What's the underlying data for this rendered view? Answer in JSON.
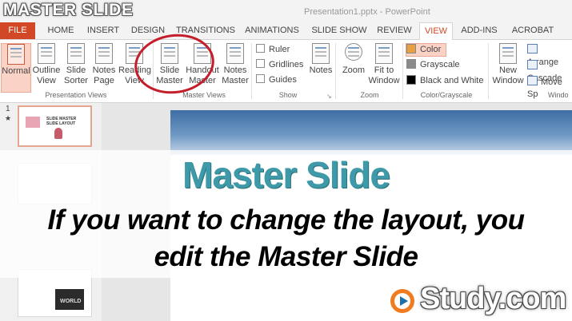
{
  "video_title": "MASTER SLIDE",
  "document_title": "Presentation1.pptx - PowerPoint",
  "tabs": [
    {
      "label": "FILE"
    },
    {
      "label": "HOME"
    },
    {
      "label": "INSERT"
    },
    {
      "label": "DESIGN"
    },
    {
      "label": "TRANSITIONS"
    },
    {
      "label": "ANIMATIONS"
    },
    {
      "label": "SLIDE SHOW"
    },
    {
      "label": "REVIEW"
    },
    {
      "label": "VIEW"
    },
    {
      "label": "ADD-INS"
    },
    {
      "label": "ACROBAT"
    }
  ],
  "active_tab": "VIEW",
  "ribbon": {
    "presentation_views": {
      "label": "Presentation Views",
      "normal": {
        "line1": "Normal",
        "line2": ""
      },
      "outline": {
        "line1": "Outline",
        "line2": "View"
      },
      "sorter": {
        "line1": "Slide",
        "line2": "Sorter"
      },
      "notes_page": {
        "line1": "Notes",
        "line2": "Page"
      },
      "reading": {
        "line1": "Reading",
        "line2": "View"
      }
    },
    "master_views": {
      "label": "Master Views",
      "slide_master": {
        "line1": "Slide",
        "line2": "Master"
      },
      "handout_master": {
        "line1": "Handout",
        "line2": "Master"
      },
      "notes_master": {
        "line1": "Notes",
        "line2": "Master"
      }
    },
    "show": {
      "label": "Show",
      "ruler": "Ruler",
      "gridlines": "Gridlines",
      "guides": "Guides",
      "notes": "Notes"
    },
    "zoom": {
      "label": "Zoom",
      "zoom": {
        "line1": "Zoom",
        "line2": ""
      },
      "fit": {
        "line1": "Fit to",
        "line2": "Window"
      }
    },
    "color": {
      "label": "Color/Grayscale",
      "color": "Color",
      "grayscale": "Grayscale",
      "bw": "Black and White",
      "swatches": {
        "color": "#e8a040",
        "grayscale": "#8a8a8a",
        "bw": "#000000"
      }
    },
    "window": {
      "label": "Windo",
      "new_window": {
        "line1": "New",
        "line2": "Window"
      },
      "arrange": "Arrange",
      "cascade": "Cascade",
      "move_split": "Move Sp"
    }
  },
  "thumbnails": {
    "slide_number": "1",
    "star": "★",
    "slide1_title": "SLIDE MASTER SLIDE LAYOUT",
    "slide3_text": "WORLD"
  },
  "overlay": {
    "title": "Master Slide",
    "line1": "If you want to change the layout, you",
    "line2": "edit the Master Slide"
  },
  "logo": {
    "text": "Study.com"
  },
  "colors": {
    "accent": "#d24726",
    "annotation_circle": "#c41e2b",
    "caption_title": "#3e9aa8"
  }
}
